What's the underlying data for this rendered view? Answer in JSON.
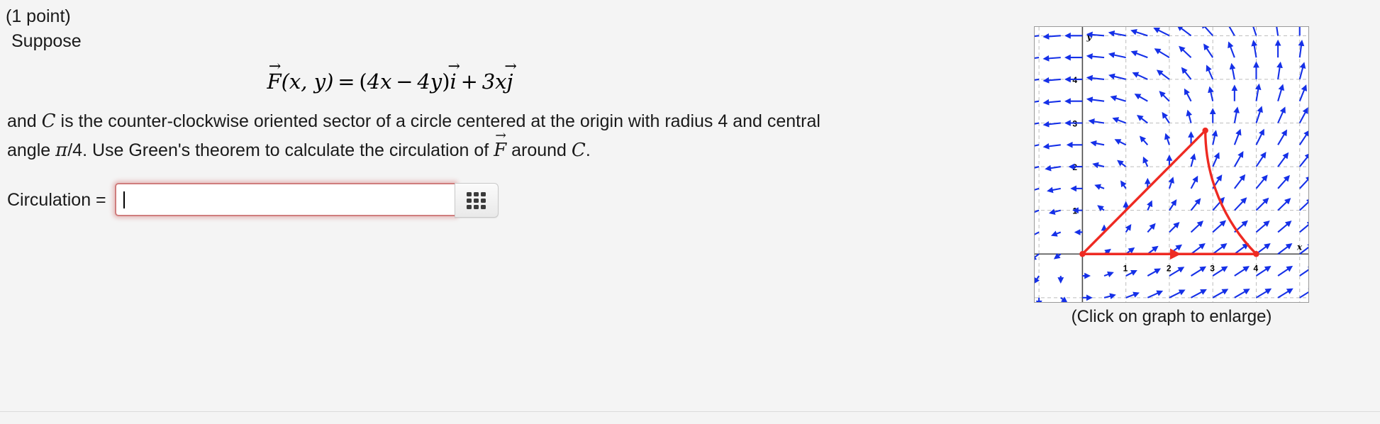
{
  "problem": {
    "points_label": "(1 point)",
    "intro": "Suppose",
    "formula": {
      "lhs_vec": "F",
      "lhs_args": "(x, y)",
      "equals": "=",
      "open_paren": "(",
      "term1": "4x",
      "minus": "−",
      "term2": "4y",
      "close_paren": ")",
      "i_vec": "i",
      "plus": "+",
      "term3": "3x",
      "j_vec": "j",
      "vector_arrow": "→",
      "plain": "F⃗(x, y) = (4x − 4y)i⃗ + 3xj⃗"
    },
    "line1_a": "and ",
    "line1_C": "C",
    "line1_b": " is the counter-clockwise oriented sector of a circle centered at the origin with radius 4 and central",
    "line2_a": "angle ",
    "line2_pi": "π",
    "line2_b": "/4. Use Green's theorem to calculate the circulation of ",
    "line2_F": "F",
    "line2_c": " around ",
    "line2_C": "C",
    "line2_d": "."
  },
  "answer": {
    "label": "Circulation =",
    "value": "",
    "placeholder": "",
    "grid_button_icon": "grid-3x3-icon",
    "border_color": "#cf7d7d",
    "glow_color": "rgba(214,130,130,0.45)"
  },
  "graph": {
    "caption": "(Click on graph to enlarge)",
    "x_axis_label": "x",
    "y_axis_label": "y",
    "x_ticks": [
      "1",
      "2",
      "3",
      "4"
    ],
    "y_ticks": [
      "1",
      "2",
      "3",
      "4"
    ],
    "field_color": "#1530e8",
    "curve_color": "#ee2a22",
    "axis_color": "#4a4a4a",
    "grid_color": "#bdbdbd"
  },
  "chart_data": {
    "type": "scatter",
    "title": "",
    "xlabel": "x",
    "ylabel": "y",
    "xlim": [
      -1.1,
      5.2
    ],
    "ylim": [
      -1.1,
      5.2
    ],
    "grid": true,
    "legend": "none",
    "vector_field": {
      "description": "Direction field of F(x,y) = (4x - 4y) i + 3x j, arrows normalized",
      "fx": "4x - 4y",
      "fy": "3x",
      "sample_step": 0.5,
      "x_range": [
        -1.0,
        5.0
      ],
      "y_range": [
        -1.0,
        5.0
      ],
      "color": "#1530e8"
    },
    "curve": {
      "name": "C: counter-clockwise sector, radius 4, central angle pi/4",
      "color": "#ee2a22",
      "segments": [
        {
          "type": "segment",
          "from": [
            0,
            0
          ],
          "to": [
            4,
            0
          ],
          "direction_arrow_at": [
            2,
            0
          ]
        },
        {
          "type": "arc",
          "center": [
            0,
            0
          ],
          "radius": 4,
          "theta_start_deg": 0,
          "theta_end_deg": 45
        },
        {
          "type": "segment",
          "from": [
            2.828,
            2.828
          ],
          "to": [
            0,
            0
          ]
        }
      ],
      "marked_points": [
        [
          0,
          0
        ],
        [
          4,
          0
        ],
        [
          2.828,
          2.828
        ]
      ]
    }
  }
}
